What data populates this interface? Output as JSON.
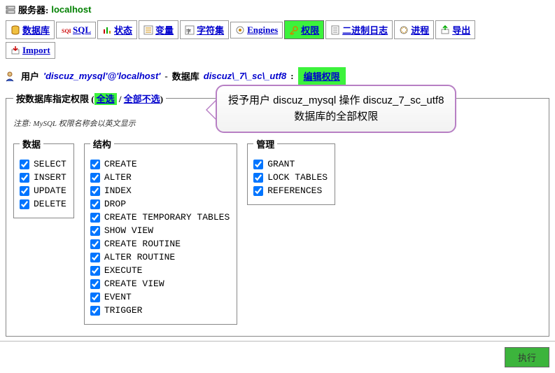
{
  "server": {
    "label": "服务器:",
    "name": "localhost"
  },
  "tabs": [
    {
      "label": "数据库",
      "icon": "database-icon",
      "active": false
    },
    {
      "label": "SQL",
      "icon": "sql-icon",
      "active": false
    },
    {
      "label": "状态",
      "icon": "status-icon",
      "active": false
    },
    {
      "label": "变量",
      "icon": "vars-icon",
      "active": false
    },
    {
      "label": "字符集",
      "icon": "charset-icon",
      "active": false
    },
    {
      "label": "Engines",
      "icon": "engines-icon",
      "active": false
    },
    {
      "label": "权限",
      "icon": "privileges-icon",
      "active": true
    },
    {
      "label": "二进制日志",
      "icon": "binlog-icon",
      "active": false
    },
    {
      "label": "进程",
      "icon": "processes-icon",
      "active": false
    },
    {
      "label": "导出",
      "icon": "export-icon",
      "active": false
    }
  ],
  "tabs2": [
    {
      "label": "Import",
      "icon": "import-icon",
      "active": false
    }
  ],
  "title": {
    "user_label": "用户",
    "user_value": "'discuz_mysql'@'localhost'",
    "sep": "-",
    "db_label": "数据库",
    "db_value": "discuz\\_7\\_sc\\_utf8",
    "colon": ":",
    "edit_btn": "编辑权限"
  },
  "main_fieldset": {
    "legend_prefix": "按数据库指定权限",
    "select_all": "全选",
    "deselect_all": "全部不选",
    "legend_divider": "/",
    "note": "注意: MySQL 权限名称会以英文显示"
  },
  "groups": {
    "data": {
      "title": "数据",
      "items": [
        {
          "label": "SELECT",
          "checked": true
        },
        {
          "label": "INSERT",
          "checked": true
        },
        {
          "label": "UPDATE",
          "checked": true
        },
        {
          "label": "DELETE",
          "checked": true
        }
      ]
    },
    "structure": {
      "title": "结构",
      "items": [
        {
          "label": "CREATE",
          "checked": true
        },
        {
          "label": "ALTER",
          "checked": true
        },
        {
          "label": "INDEX",
          "checked": true
        },
        {
          "label": "DROP",
          "checked": true
        },
        {
          "label": "CREATE TEMPORARY TABLES",
          "checked": true
        },
        {
          "label": "SHOW VIEW",
          "checked": true
        },
        {
          "label": "CREATE ROUTINE",
          "checked": true
        },
        {
          "label": "ALTER ROUTINE",
          "checked": true
        },
        {
          "label": "EXECUTE",
          "checked": true
        },
        {
          "label": "CREATE VIEW",
          "checked": true
        },
        {
          "label": "EVENT",
          "checked": true
        },
        {
          "label": "TRIGGER",
          "checked": true
        }
      ]
    },
    "admin": {
      "title": "管理",
      "items": [
        {
          "label": "GRANT",
          "checked": true
        },
        {
          "label": "LOCK TABLES",
          "checked": true
        },
        {
          "label": "REFERENCES",
          "checked": true
        }
      ]
    }
  },
  "callout": {
    "line1": "授予用户 discuz_mysql 操作 discuz_7_sc_utf8",
    "line2": "数据库的全部权限"
  },
  "footer": {
    "execute": "执行"
  }
}
